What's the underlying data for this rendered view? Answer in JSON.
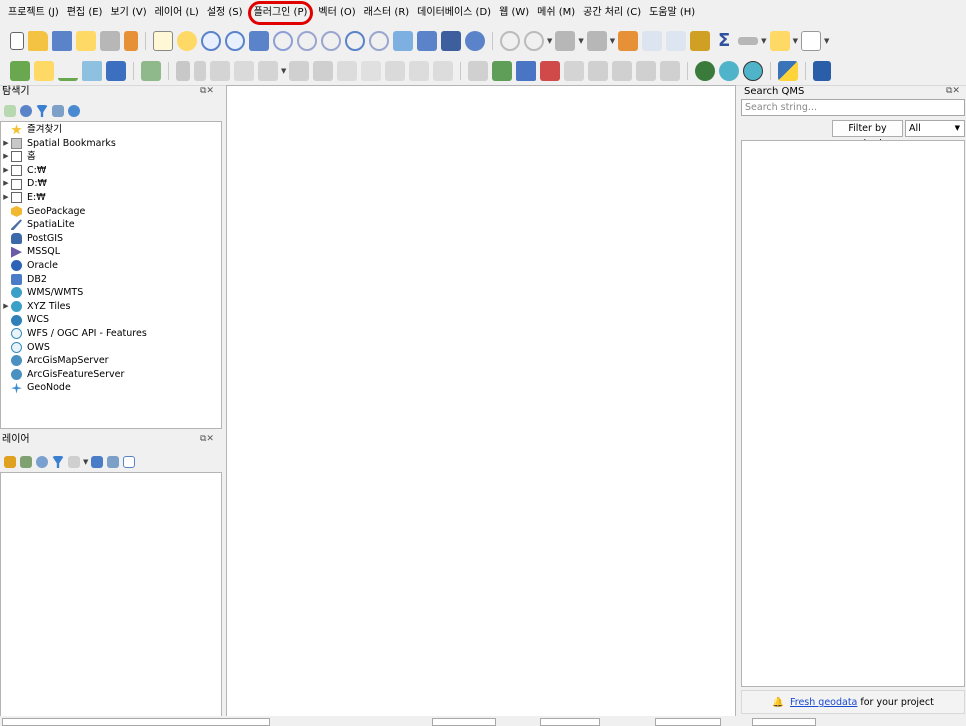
{
  "menu": [
    {
      "label": "프로젝트 (J)"
    },
    {
      "label": "편집 (E)"
    },
    {
      "label": "보기 (V)"
    },
    {
      "label": "레이어 (L)"
    },
    {
      "label": "설정 (S)"
    },
    {
      "label": "플러그인 (P)",
      "highlighted": true
    },
    {
      "label": "벡터 (O)"
    },
    {
      "label": "래스터 (R)"
    },
    {
      "label": "데이터베이스 (D)"
    },
    {
      "label": "웹 (W)"
    },
    {
      "label": "메쉬 (M)"
    },
    {
      "label": "공간 처리 (C)"
    },
    {
      "label": "도움말 (H)"
    }
  ],
  "highlight_color": "#e00000",
  "browser": {
    "title": "탐색기",
    "items": [
      {
        "label": "즐겨찾기",
        "icon": "star-icon",
        "expandable": false
      },
      {
        "label": "Spatial Bookmarks",
        "icon": "bookmark-icon",
        "expandable": true
      },
      {
        "label": "홈",
        "icon": "home-folder-icon",
        "expandable": true
      },
      {
        "label": "C:₩",
        "icon": "drive-folder-icon",
        "expandable": true
      },
      {
        "label": "D:₩",
        "icon": "drive-folder-icon",
        "expandable": true
      },
      {
        "label": "E:₩",
        "icon": "drive-folder-icon",
        "expandable": true
      },
      {
        "label": "GeoPackage",
        "icon": "geopackage-icon",
        "expandable": false
      },
      {
        "label": "SpatiaLite",
        "icon": "spatialite-icon",
        "expandable": false
      },
      {
        "label": "PostGIS",
        "icon": "postgis-icon",
        "expandable": false
      },
      {
        "label": "MSSQL",
        "icon": "mssql-icon",
        "expandable": false
      },
      {
        "label": "Oracle",
        "icon": "oracle-icon",
        "expandable": false
      },
      {
        "label": "DB2",
        "icon": "db2-icon",
        "expandable": false
      },
      {
        "label": "WMS/WMTS",
        "icon": "wms-icon",
        "expandable": false
      },
      {
        "label": "XYZ Tiles",
        "icon": "xyz-tiles-icon",
        "expandable": true
      },
      {
        "label": "WCS",
        "icon": "wcs-icon",
        "expandable": false
      },
      {
        "label": "WFS / OGC API - Features",
        "icon": "wfs-icon",
        "expandable": false
      },
      {
        "label": "OWS",
        "icon": "ows-icon",
        "expandable": false
      },
      {
        "label": "ArcGisMapServer",
        "icon": "arcgis-mapserver-icon",
        "expandable": false
      },
      {
        "label": "ArcGisFeatureServer",
        "icon": "arcgis-featureserver-icon",
        "expandable": false
      },
      {
        "label": "GeoNode",
        "icon": "geonode-icon",
        "expandable": false
      }
    ]
  },
  "layers": {
    "title": "레이어"
  },
  "qms": {
    "title": "Search QMS",
    "search_placeholder": "Search string...",
    "filter_button": "Filter by extent",
    "filter_select": "All",
    "footer_link": "Fresh geodata",
    "footer_text": " for your project"
  }
}
